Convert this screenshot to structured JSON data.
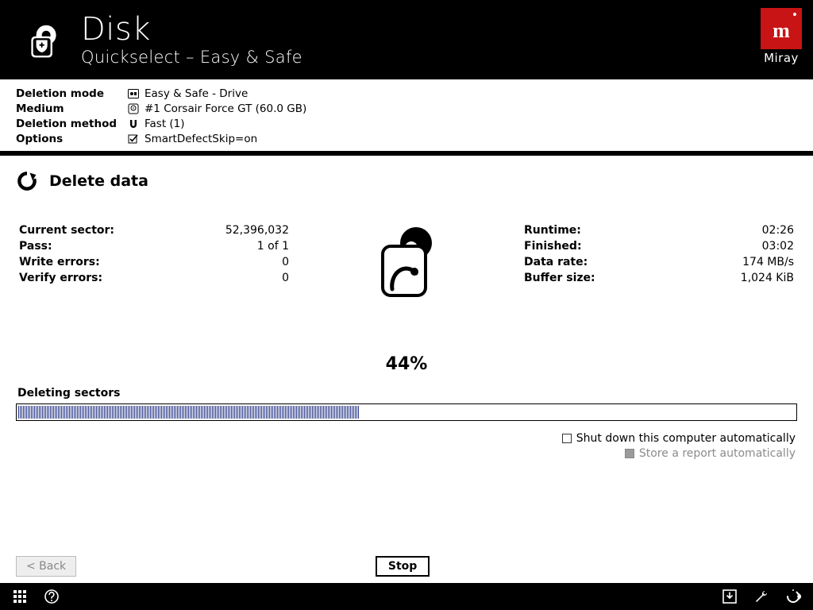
{
  "header": {
    "title": "Disk",
    "subtitle": "Quickselect – Easy & Safe"
  },
  "brand": "Miray",
  "info": {
    "deletion_mode_label": "Deletion mode",
    "deletion_mode_value": "Easy & Safe - Drive",
    "medium_label": "Medium",
    "medium_value": "#1 Corsair Force GT (60.0 GB)",
    "method_label": "Deletion method",
    "method_value": "Fast (1)",
    "options_label": "Options",
    "options_value": "SmartDefectSkip=on"
  },
  "section_title": "Delete data",
  "stats_left": {
    "current_sector_k": "Current sector:",
    "current_sector_v": "52,396,032",
    "pass_k": "Pass:",
    "pass_v": "1 of 1",
    "write_errors_k": "Write errors:",
    "write_errors_v": "0",
    "verify_errors_k": "Verify errors:",
    "verify_errors_v": "0"
  },
  "stats_right": {
    "runtime_k": "Runtime:",
    "runtime_v": "02:26",
    "finished_k": "Finished:",
    "finished_v": "03:02",
    "data_rate_k": "Data rate:",
    "data_rate_v": "174 MB/s",
    "buffer_k": "Buffer size:",
    "buffer_v": "1,024 KiB"
  },
  "progress": {
    "percent_label": "44%",
    "percent_value": 44,
    "action_label": "Deleting sectors"
  },
  "options_under": {
    "shutdown": "Shut down this computer automatically",
    "report": "Store a report automatically"
  },
  "buttons": {
    "back": "<  Back",
    "stop": "Stop"
  }
}
